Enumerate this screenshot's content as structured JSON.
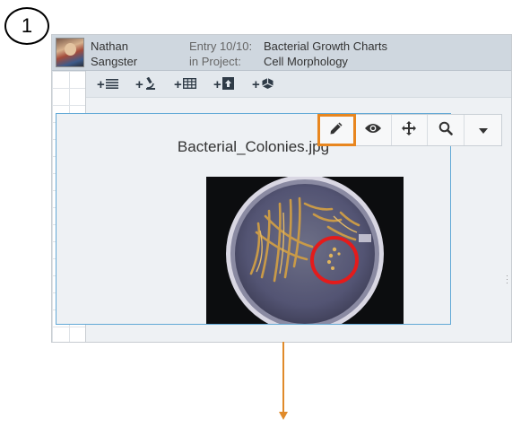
{
  "step": {
    "number": "1"
  },
  "header": {
    "user_first": "Nathan",
    "user_last": "Sangster",
    "entry_label": "Entry 10/10:",
    "project_label": "in Project:",
    "entry_value": "Bacterial Growth Charts",
    "project_value": "Cell Morphology"
  },
  "add_toolbar": {
    "items": [
      {
        "icon": "text-list-icon",
        "plus": "+"
      },
      {
        "icon": "microscope-icon",
        "plus": "+"
      },
      {
        "icon": "table-icon",
        "plus": "+"
      },
      {
        "icon": "upload-file-icon",
        "plus": "+"
      },
      {
        "icon": "molecule-icon",
        "plus": "+"
      }
    ]
  },
  "image_panel": {
    "filename": "Bacterial_Colonies.jpg"
  },
  "image_toolbar": {
    "tools": [
      {
        "name": "edit",
        "icon": "pencil-icon",
        "highlighted": true
      },
      {
        "name": "view",
        "icon": "eye-icon",
        "highlighted": false
      },
      {
        "name": "move",
        "icon": "move-arrows-icon",
        "highlighted": false
      },
      {
        "name": "zoom",
        "icon": "magnifier-icon",
        "highlighted": false
      },
      {
        "name": "more",
        "icon": "caret-down-icon",
        "highlighted": false
      }
    ]
  },
  "colors": {
    "highlight": "#e8861f",
    "panel_border": "#62a9d6",
    "header_bg": "#cfd7df",
    "arrow": "#e08a2a",
    "annotation_circle": "#e41b1b"
  }
}
